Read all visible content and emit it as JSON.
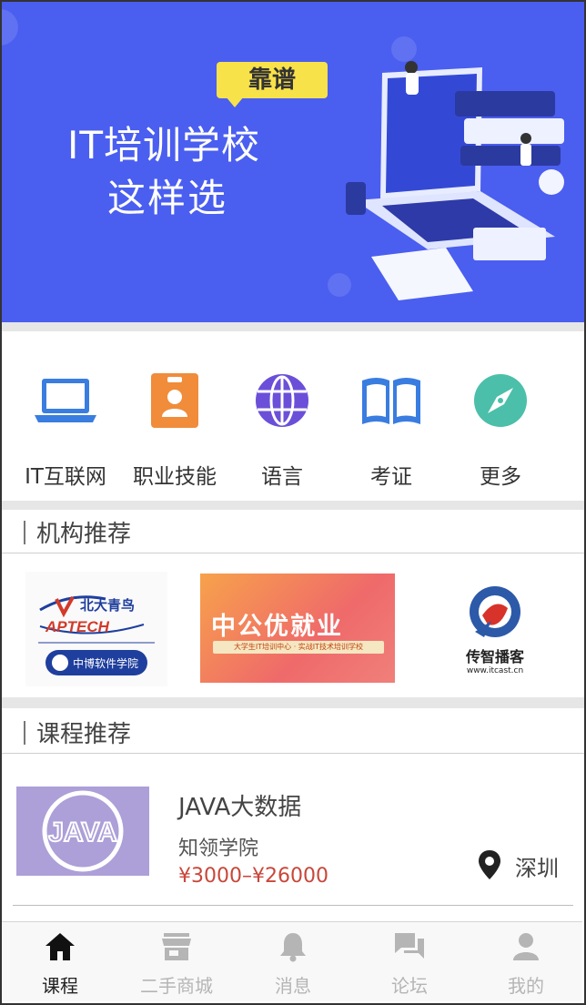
{
  "banner": {
    "tag": "靠谱",
    "title_line1": "IT培训学校",
    "title_line2": "这样选"
  },
  "categories": [
    {
      "label": "IT互联网",
      "icon": "laptop-icon",
      "color": "#3a7de0"
    },
    {
      "label": "职业技能",
      "icon": "badge-icon",
      "color": "#f08c3a"
    },
    {
      "label": "语言",
      "icon": "globe-icon",
      "color": "#6b4fd8"
    },
    {
      "label": "考证",
      "icon": "book-icon",
      "color": "#3a7de0"
    },
    {
      "label": "更多",
      "icon": "compass-icon",
      "color": "#4bbfaa"
    }
  ],
  "sections": {
    "orgs_title": "机构推荐",
    "courses_title": "课程推荐"
  },
  "orgs": [
    {
      "name": "北大青鸟",
      "sub": "APTECH",
      "sub2": "中博软件学院"
    },
    {
      "name": "中公优就业",
      "sub": "大学生IT培训中心 · 实战IT技术培训学校"
    },
    {
      "name": "传智播客",
      "sub": "www.itcast.cn"
    }
  ],
  "course": {
    "thumb_label": "JAVA",
    "title": "JAVA大数据",
    "school": "知领学院",
    "price": "¥3000–¥26000",
    "city": "深圳"
  },
  "tabs": [
    {
      "label": "课程",
      "icon": "home-icon",
      "active": true
    },
    {
      "label": "二手商城",
      "icon": "store-icon",
      "active": false
    },
    {
      "label": "消息",
      "icon": "bell-icon",
      "active": false
    },
    {
      "label": "论坛",
      "icon": "chat-icon",
      "active": false
    },
    {
      "label": "我的",
      "icon": "user-icon",
      "active": false
    }
  ]
}
